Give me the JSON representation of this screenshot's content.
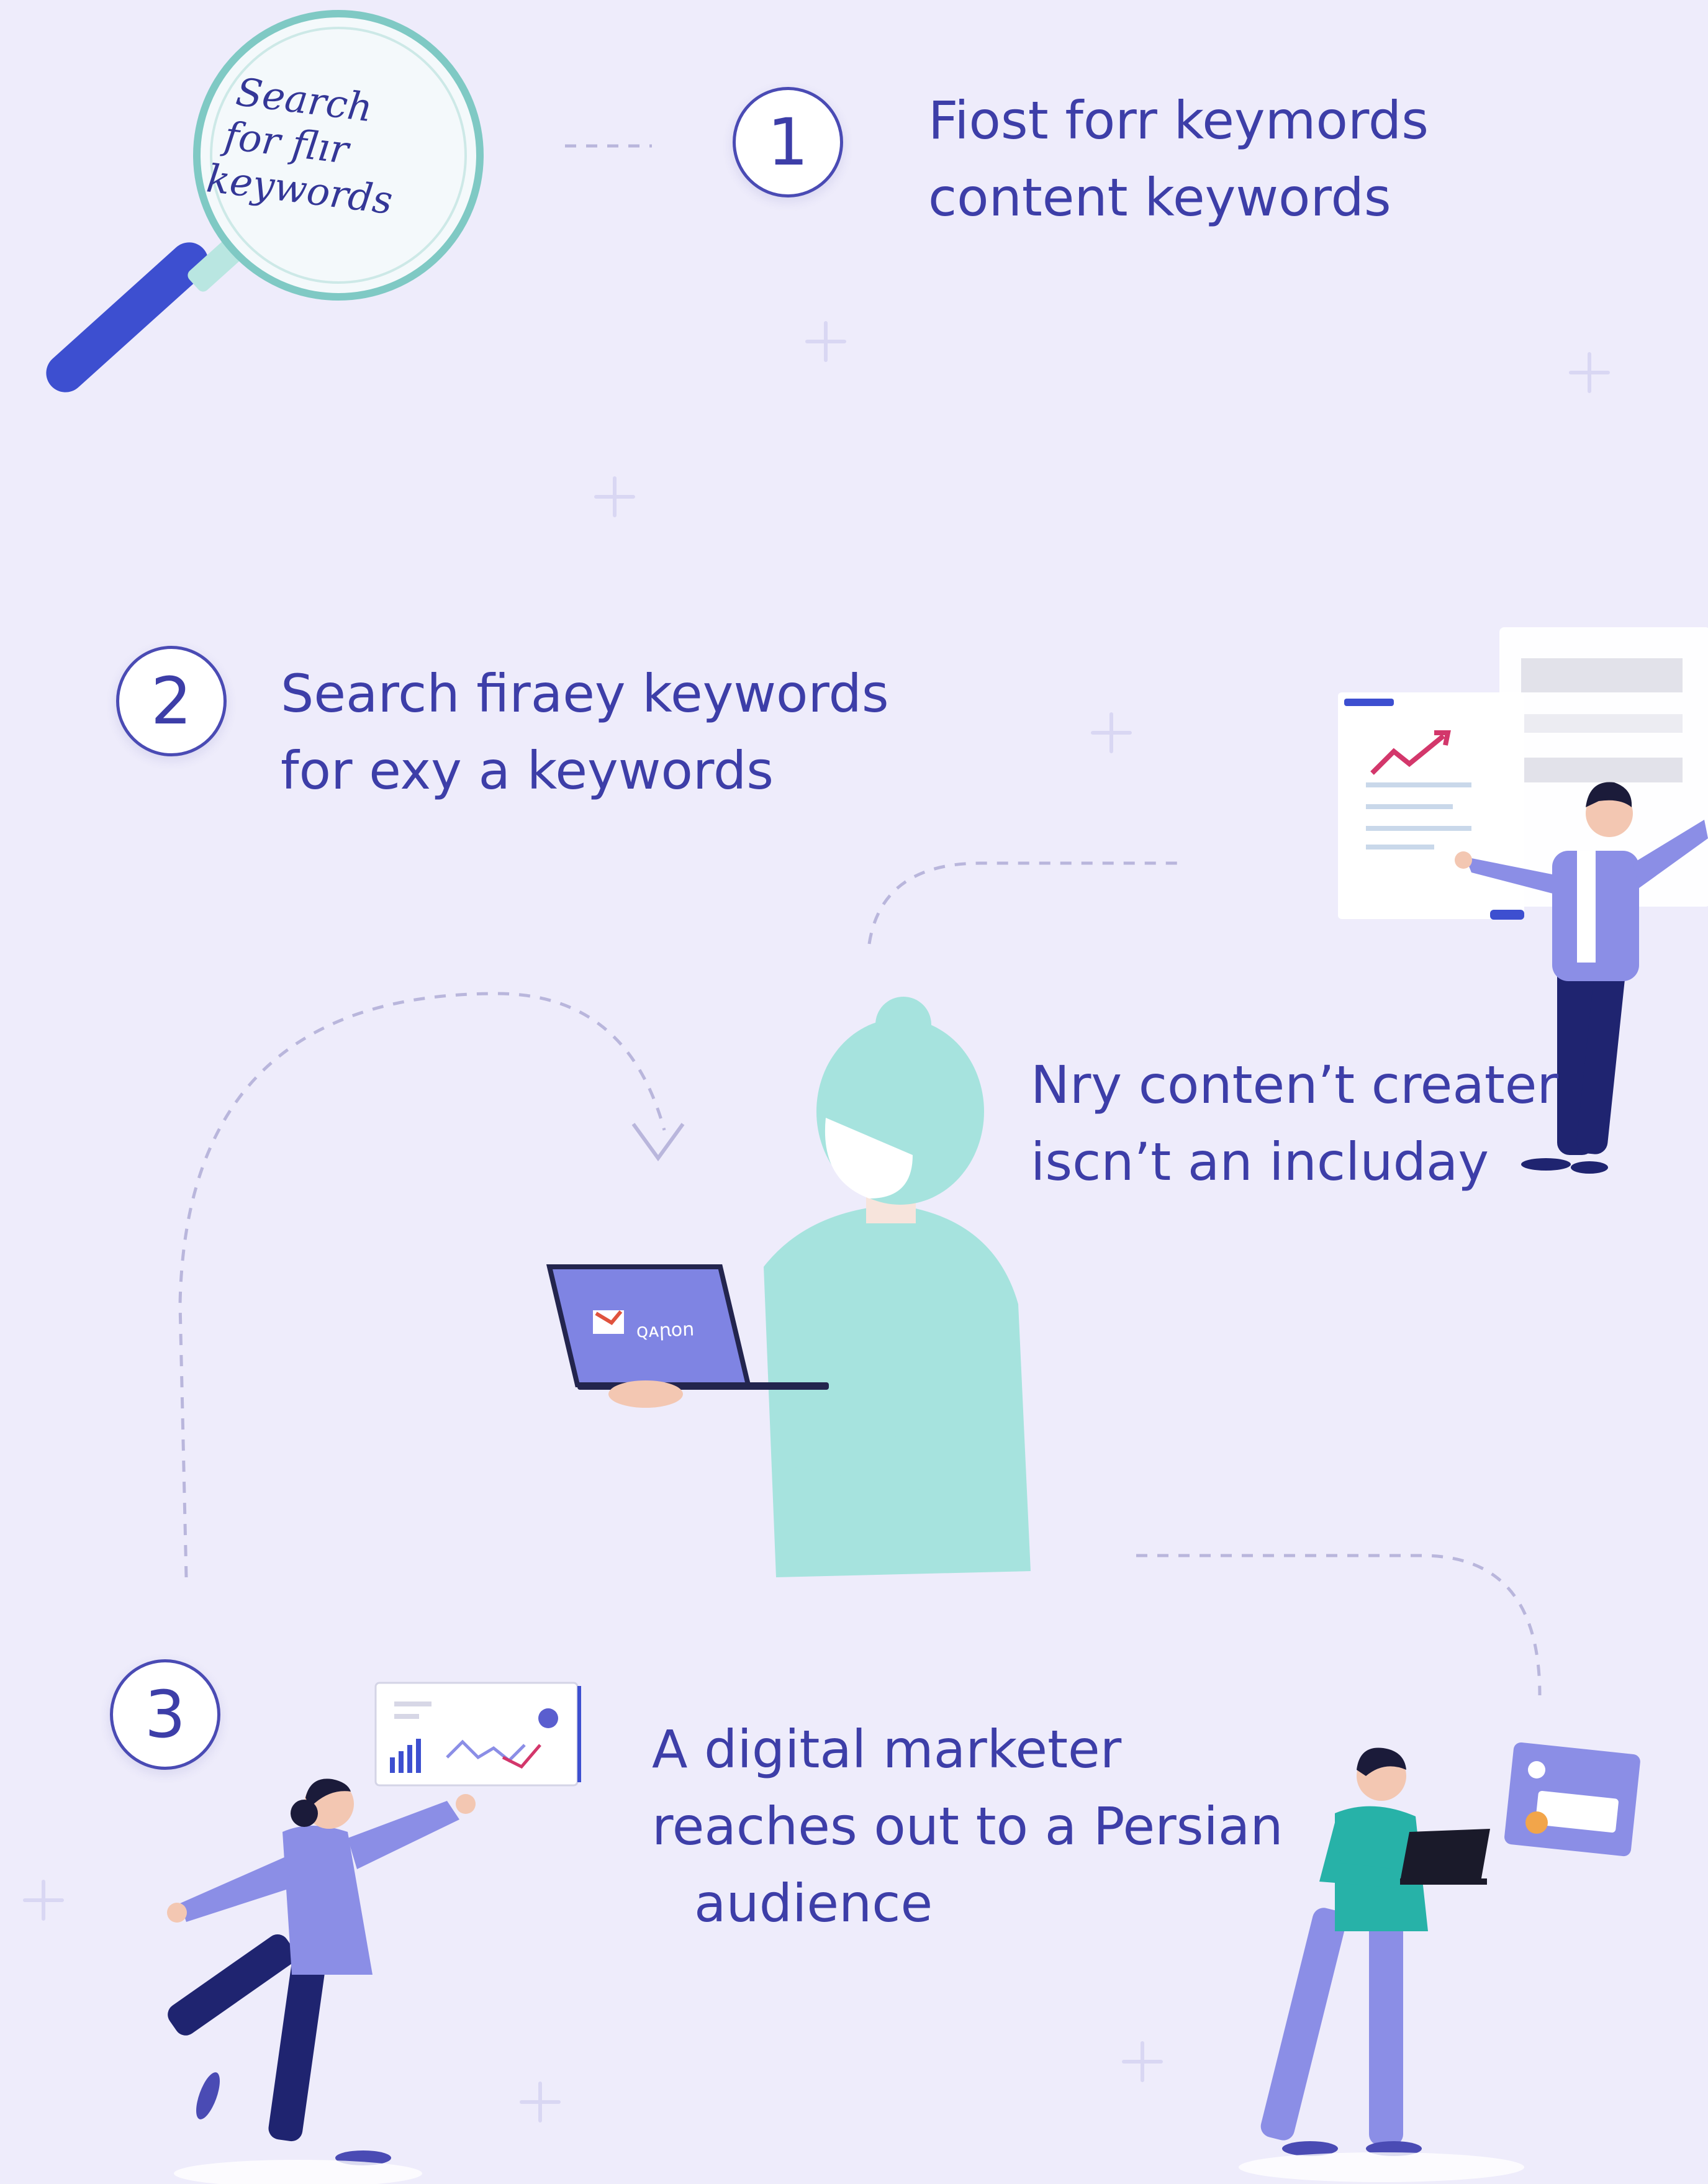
{
  "magnifier": {
    "lines": [
      "Search",
      "for flır",
      "keywords"
    ]
  },
  "steps": [
    {
      "number": "1",
      "lines": [
        "Fiost forr keymords",
        "content keywords"
      ]
    },
    {
      "number": "2",
      "lines": [
        "Search firaey keywords",
        "for exy a keywords"
      ]
    },
    {
      "number": "3",
      "lines": [
        "A digital marketer",
        "reaches out to a Persian",
        "audience"
      ]
    }
  ],
  "center_caption": {
    "lines": [
      "Nry conten’t creater",
      "iscn’t an includay"
    ]
  },
  "laptop_screen": {
    "label": "ꞯᴀꞃᴏn"
  },
  "colors": {
    "background": "#eeecfb",
    "text": "#3d3ea8",
    "accent_blue": "#3d4fd0",
    "mint": "#a6e3de",
    "lavender": "#8b8ee6",
    "navy": "#1f2470"
  },
  "icons": [
    "magnifier-icon",
    "line-chart-icon",
    "bar-chart-icon",
    "laptop-icon"
  ]
}
